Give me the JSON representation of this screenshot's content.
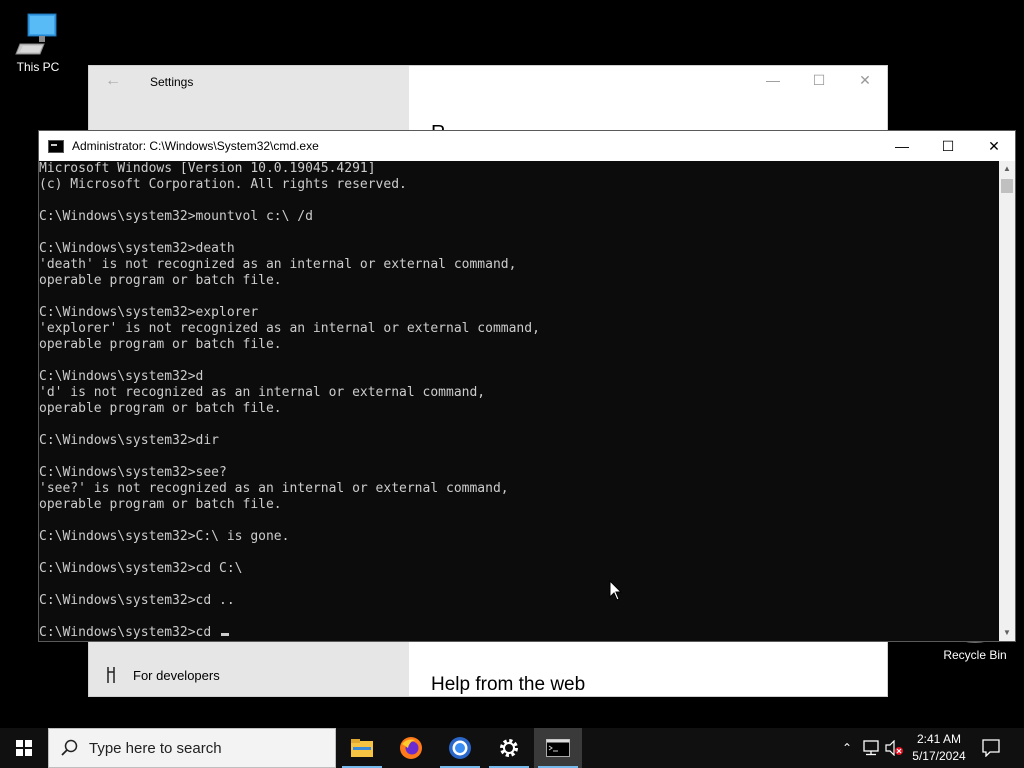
{
  "desktop": {
    "icons": [
      {
        "label": "This PC"
      },
      {
        "label": "Recycle Bin"
      }
    ]
  },
  "settings_window": {
    "title": "Settings",
    "partial_heading": "R",
    "sidebar_item": "For developers",
    "help_heading": "Help from the web"
  },
  "cmd_window": {
    "title": "Administrator: C:\\Windows\\System32\\cmd.exe",
    "lines": [
      "Microsoft Windows [Version 10.0.19045.4291]",
      "(c) Microsoft Corporation. All rights reserved.",
      "",
      "C:\\Windows\\system32>mountvol c:\\ /d",
      "",
      "C:\\Windows\\system32>death",
      "'death' is not recognized as an internal or external command,",
      "operable program or batch file.",
      "",
      "C:\\Windows\\system32>explorer",
      "'explorer' is not recognized as an internal or external command,",
      "operable program or batch file.",
      "",
      "C:\\Windows\\system32>d",
      "'d' is not recognized as an internal or external command,",
      "operable program or batch file.",
      "",
      "C:\\Windows\\system32>dir",
      "",
      "C:\\Windows\\system32>see?",
      "'see?' is not recognized as an internal or external command,",
      "operable program or batch file.",
      "",
      "C:\\Windows\\system32>C:\\ is gone.",
      "",
      "C:\\Windows\\system32>cd C:\\",
      "",
      "C:\\Windows\\system32>cd ..",
      ""
    ],
    "current_prompt": "C:\\Windows\\system32>cd "
  },
  "taskbar": {
    "search_placeholder": "Type here to search",
    "apps": [
      {
        "icon": "file-explorer-icon"
      },
      {
        "icon": "firefox-icon"
      },
      {
        "icon": "chrome-icon"
      },
      {
        "icon": "settings-gear-icon"
      },
      {
        "icon": "command-prompt-icon",
        "active": true
      }
    ],
    "clock": {
      "time": "2:41 AM",
      "date": "5/17/2024"
    }
  },
  "colors": {
    "console_bg": "#0c0c0c",
    "console_fg": "#cccccc",
    "taskbar_bg": "#101010",
    "accent": "#76b9ed"
  }
}
